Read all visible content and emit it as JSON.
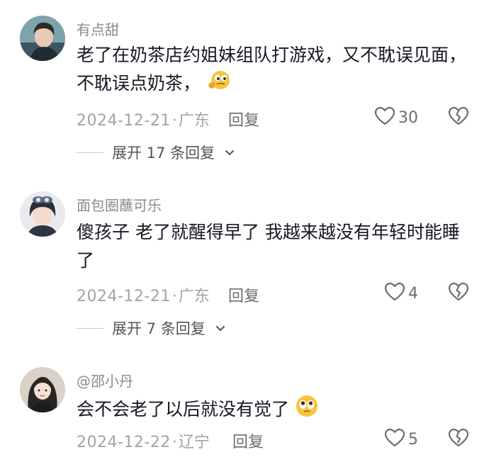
{
  "comments": [
    {
      "username": "有点甜",
      "text": "老了在奶茶店约姐妹组队打游戏，又不耽误见面，不耽误点奶茶，",
      "emoji": "thinking-face-emoji",
      "date": "2024-12-21",
      "location": "广东",
      "reply_label": "回复",
      "likes": "30",
      "expand_label": "展开 17 条回复"
    },
    {
      "username": "面包圈蘸可乐",
      "text": "傻孩子 老了就醒得早了 我越来越没有年轻时能睡了",
      "date": "2024-12-21",
      "location": "广东",
      "reply_label": "回复",
      "likes": "4",
      "expand_label": "展开 7 条回复"
    },
    {
      "username": "@邵小丹",
      "text": "会不会老了以后就没有觉了",
      "emoji": "pleading-face-emoji",
      "date": "2024-12-22",
      "location": "辽宁",
      "reply_label": "回复",
      "likes": "5"
    }
  ],
  "separator": "·",
  "icons": {
    "like": "heart-icon",
    "dislike": "broken-heart-icon",
    "expand": "chevron-down-icon"
  },
  "colors": {
    "text": "#161823",
    "muted": "#a2a3a8",
    "username": "#8a8b91"
  }
}
